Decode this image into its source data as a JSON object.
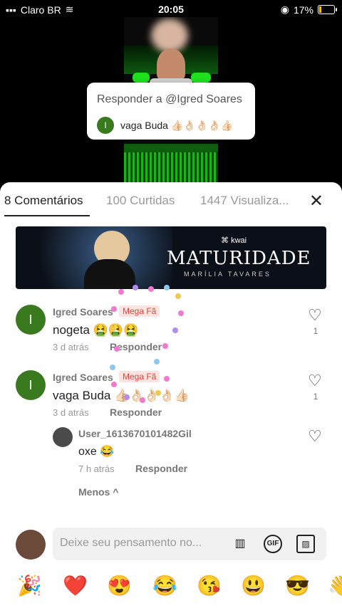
{
  "status_bar": {
    "carrier": "Claro BR",
    "time": "20:05",
    "battery": "17%"
  },
  "reply_popup": {
    "title": "Responder a @Igred Soares",
    "avatar_letter": "I",
    "text": "vaga Buda",
    "emojis": "👍🏻👌🏻👌🏻👌🏻👍🏻"
  },
  "tabs": [
    {
      "label": "8 Comentários"
    },
    {
      "label": "100 Curtidas"
    },
    {
      "label": "1447 Visualiza..."
    }
  ],
  "close_icon": "✕",
  "banner": {
    "brand": "kwai",
    "title": "MATURIDADE",
    "subtitle": "MARÍLIA TAVARES"
  },
  "comments": [
    {
      "avatar_letter": "I",
      "name": "Igred Soares",
      "badge": "Mega Fã",
      "text": "nogeta 🤮🤮🤮",
      "time": "3 d atrás",
      "reply": "Responder",
      "likes": "1"
    },
    {
      "avatar_letter": "I",
      "name": "Igred Soares",
      "badge": "Mega Fã",
      "text": "vaga Buda 👍🏻👌🏻👌🏻👌🏻👍🏻",
      "time": "3 d atrás",
      "reply": "Responder",
      "likes": "1"
    }
  ],
  "sub_comment": {
    "name": "User_1613670101482Gil",
    "text": "oxe 😂",
    "time": "7 h atrás",
    "reply": "Responder"
  },
  "less_label": "Menos ^",
  "input": {
    "placeholder": "Deixe seu pensamento no..."
  },
  "input_buttons": {
    "gif": "GIF"
  },
  "emoji_bar": [
    "🎉",
    "❤️",
    "😍",
    "😂",
    "😘",
    "😃",
    "😎",
    "👋"
  ],
  "colors": {
    "accent_red": "#e0443a",
    "avatar_green": "#3a7a1e"
  }
}
